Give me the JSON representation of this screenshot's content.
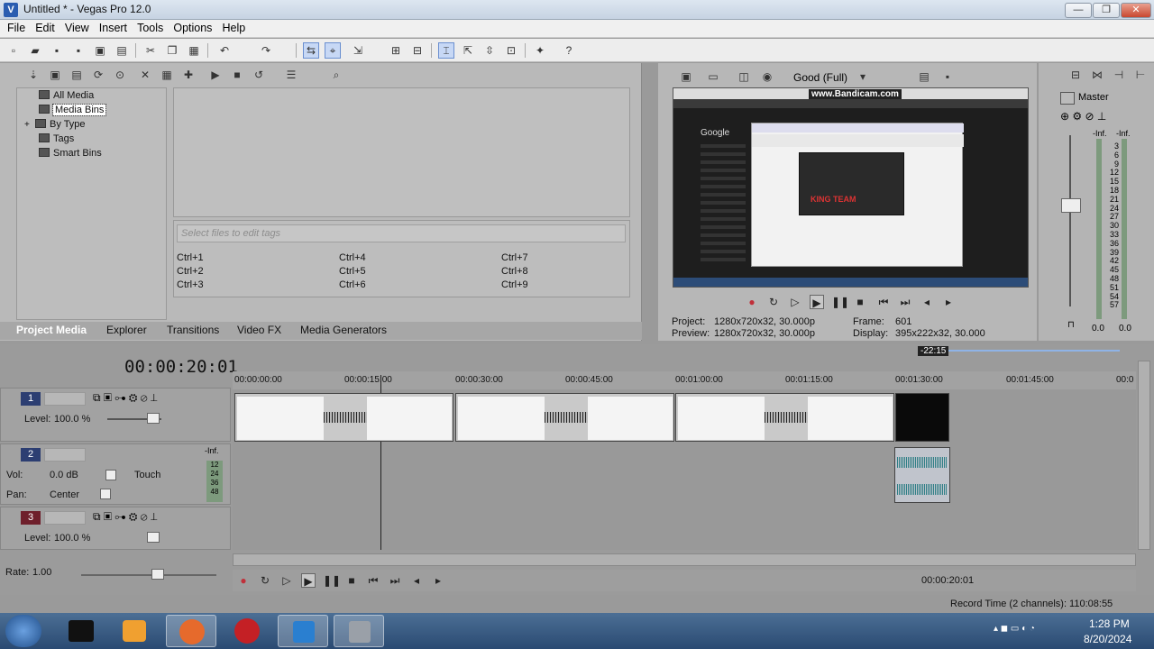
{
  "window": {
    "title": "Untitled * - Vegas Pro 12.0",
    "app_icon": "vegas-icon"
  },
  "menu": [
    "File",
    "Edit",
    "View",
    "Insert",
    "Tools",
    "Options",
    "Help"
  ],
  "media_tree": [
    "All Media",
    "Media Bins",
    "By Type",
    "Tags",
    "Smart Bins"
  ],
  "tags": {
    "placeholder": "Select files to edit tags",
    "shortcuts": [
      [
        "Ctrl+1",
        "Ctrl+4",
        "Ctrl+7"
      ],
      [
        "Ctrl+2",
        "Ctrl+5",
        "Ctrl+8"
      ],
      [
        "Ctrl+3",
        "Ctrl+6",
        "Ctrl+9"
      ]
    ]
  },
  "tabs": [
    "Project Media",
    "Explorer",
    "Transitions",
    "Video FX",
    "Media Generators"
  ],
  "preview": {
    "quality": "Good (Full)",
    "project_label": "Project:",
    "project": "1280x720x32, 30.000p",
    "preview_label": "Preview:",
    "preview": "1280x720x32, 30.000p",
    "frame_label": "Frame:",
    "frame": "601",
    "display_label": "Display:",
    "display": "395x222x32, 30.000",
    "screen_watermark": "www.Bandicam.com",
    "screen_search": "Google",
    "screen_logo": "KING TEAM"
  },
  "master": {
    "label": "Master",
    "inf": [
      "-Inf.",
      "-Inf."
    ],
    "scale": [
      "3",
      "6",
      "9",
      "12",
      "15",
      "18",
      "21",
      "24",
      "27",
      "30",
      "33",
      "36",
      "39",
      "42",
      "45",
      "48",
      "51",
      "54",
      "57"
    ],
    "readouts": [
      "0.0",
      "0.0"
    ]
  },
  "timeline": {
    "timecode": "00:00:20:01",
    "marker": "-22:15",
    "ruler": [
      "00:00:00:00",
      "00:00:15:00",
      "00:00:30:00",
      "00:00:45:00",
      "00:01:00:00",
      "00:01:15:00",
      "00:01:30:00",
      "00:01:45:00",
      "00:0"
    ],
    "tracks": [
      {
        "num": "1",
        "level_label": "Level:",
        "level": "100.0 %"
      },
      {
        "num": "2",
        "vol_label": "Vol:",
        "vol": "0.0 dB",
        "pan_label": "Pan:",
        "pan": "Center",
        "mode": "Touch",
        "inf": "-Inf.",
        "meter": [
          "12",
          "24",
          "36",
          "48"
        ]
      },
      {
        "num": "3",
        "level_label": "Level:",
        "level": "100.0 %"
      }
    ],
    "rate_label": "Rate:",
    "rate": "1.00",
    "end_timecode": "00:00:20:01",
    "record_time": "Record Time (2 channels): 110:08:55"
  },
  "taskbar": {
    "time": "1:28 PM",
    "date": "8/20/2024"
  },
  "colors": {
    "track_blue": "#2c3e72",
    "track_red": "#6e1f2b",
    "active_tab_text": "#ffffff"
  }
}
